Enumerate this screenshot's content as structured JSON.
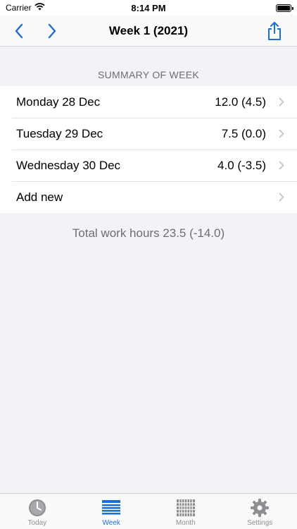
{
  "status": {
    "carrier": "Carrier",
    "time": "8:14 PM"
  },
  "nav": {
    "title": "Week 1 (2021)"
  },
  "section": {
    "header": "SUMMARY OF WEEK"
  },
  "rows": [
    {
      "label": "Monday 28 Dec",
      "value": "12.0 (4.5)"
    },
    {
      "label": "Tuesday 29 Dec",
      "value": "7.5 (0.0)"
    },
    {
      "label": "Wednesday 30 Dec",
      "value": "4.0 (-3.5)"
    },
    {
      "label": "Add new",
      "value": ""
    }
  ],
  "total": "Total work hours 23.5 (-14.0)",
  "tabs": [
    {
      "label": "Today",
      "icon": "clock-icon"
    },
    {
      "label": "Week",
      "icon": "week-list-icon",
      "active": true
    },
    {
      "label": "Month",
      "icon": "calendar-grid-icon"
    },
    {
      "label": "Settings",
      "icon": "gear-icon"
    }
  ],
  "colors": {
    "accent": "#1c6fd3",
    "inactive": "#8e8e93",
    "background": "#f2f2f7"
  }
}
